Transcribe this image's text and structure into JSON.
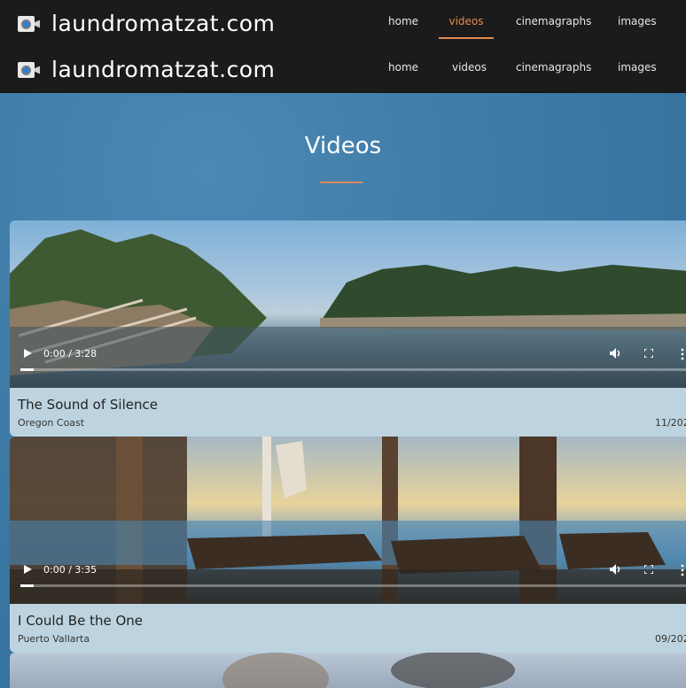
{
  "site": {
    "name": "laundromatzat.com"
  },
  "nav_top": [
    {
      "label": "home",
      "active": false
    },
    {
      "label": "videos",
      "active": true
    },
    {
      "label": "cinemagraphs",
      "active": false
    },
    {
      "label": "images",
      "active": false
    }
  ],
  "nav_sticky": [
    {
      "label": "home"
    },
    {
      "label": "videos"
    },
    {
      "label": "cinemagraphs"
    },
    {
      "label": "images"
    }
  ],
  "page": {
    "heading": "Videos"
  },
  "videos": [
    {
      "title": "The Sound of Silence",
      "location": "Oregon Coast",
      "date": "11/202",
      "time": "0:00 / 3:28",
      "progress": 0.0
    },
    {
      "title": "I Could Be the One",
      "location": "Puerto Vallarta",
      "date": "09/202",
      "time": "0:00 / 3:35",
      "progress": 0.0
    }
  ],
  "colors": {
    "accent": "#e08a4e",
    "header_bg": "#1b1b1b",
    "card_bg": "#bdd4e0"
  },
  "icons": [
    "camera-logo-icon",
    "play-icon",
    "volume-icon",
    "fullscreen-icon",
    "more-options-icon"
  ]
}
